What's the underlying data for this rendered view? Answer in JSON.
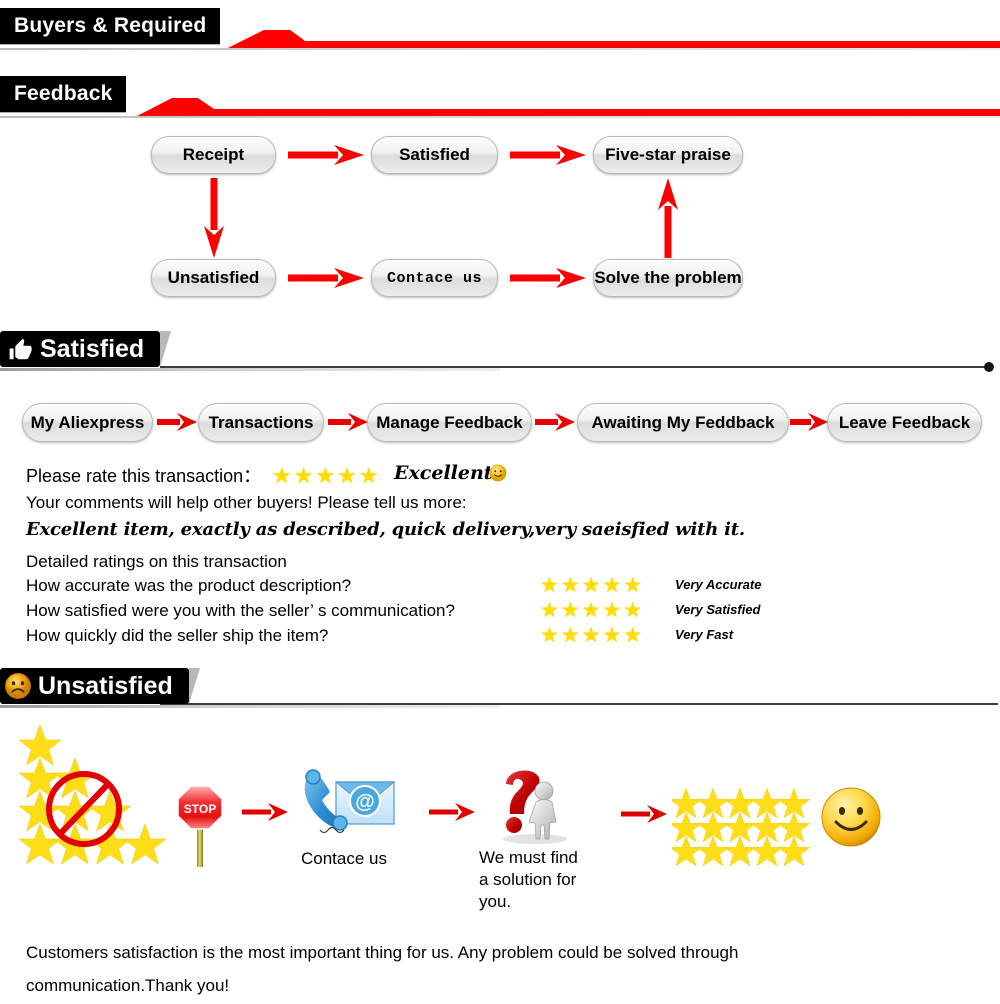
{
  "banners": [
    {
      "id": "buyers",
      "label": "Buyers & Required"
    },
    {
      "id": "feedback",
      "label": "Feedback"
    }
  ],
  "flow": {
    "nodes": [
      {
        "id": "receipt",
        "label": "Receipt"
      },
      {
        "id": "satisfied",
        "label": "Satisfied"
      },
      {
        "id": "fivestar",
        "label": "Five-star praise"
      },
      {
        "id": "unsatisfied",
        "label": "Unsatisfied"
      },
      {
        "id": "contact",
        "label": "Contace us"
      },
      {
        "id": "solve",
        "label": "Solve the problem"
      }
    ]
  },
  "satisfied_section": {
    "header": "Satisfied",
    "header_icon": "thumbs-up-icon",
    "breadcrumb": [
      "My Aliexpress",
      "Transactions",
      "Manage Feedback",
      "Awaiting My Feddback",
      "Leave Feedback"
    ],
    "rate_prompt": "Please rate this transaction：",
    "rate_stars": "★★★★★",
    "rate_word": "Excellent",
    "rate_emoji": "smiley-icon",
    "comments_prompt": "Your comments will help other buyers! Please tell us more:",
    "comment_text": "Excellent item, exactly as described, quick delivery,very saeisfied with it.",
    "detailed_heading": "Detailed ratings on this transaction",
    "detailed": [
      {
        "question": "How accurate was the product description?",
        "stars": "★★★★★",
        "label": "Very Accurate"
      },
      {
        "question": "How satisfied were you with the seller’ s communication?",
        "stars": "★★★★★",
        "label": "Very Satisfied"
      },
      {
        "question": "How quickly did the seller ship the item?",
        "stars": "★★★★★",
        "label": "Very Fast"
      }
    ]
  },
  "unsatisfied_section": {
    "header": "Unsatisfied",
    "header_icon": "frowning-face-icon",
    "steps": [
      {
        "icon": "no-stars-icon",
        "caption": ""
      },
      {
        "icon": "stop-sign-icon",
        "caption": ""
      },
      {
        "icon": "phone-email-icon",
        "caption": "Contace us"
      },
      {
        "icon": "question-mark-person-icon",
        "caption": "We must find\na solution for\nyou."
      },
      {
        "icon": "fifteen-stars-icon",
        "caption": ""
      },
      {
        "icon": "big-smiley-icon",
        "caption": ""
      }
    ],
    "stop_sign_text": "STOP",
    "at_symbol": "@"
  },
  "footer": {
    "line1": "Customers satisfaction is the most important thing for us. Any problem could be solved through",
    "line2": "communication.Thank you!"
  },
  "colors": {
    "red": "#FF0000",
    "dark_red": "#D40000",
    "star_yellow": "#FFDD00",
    "black": "#000000"
  }
}
